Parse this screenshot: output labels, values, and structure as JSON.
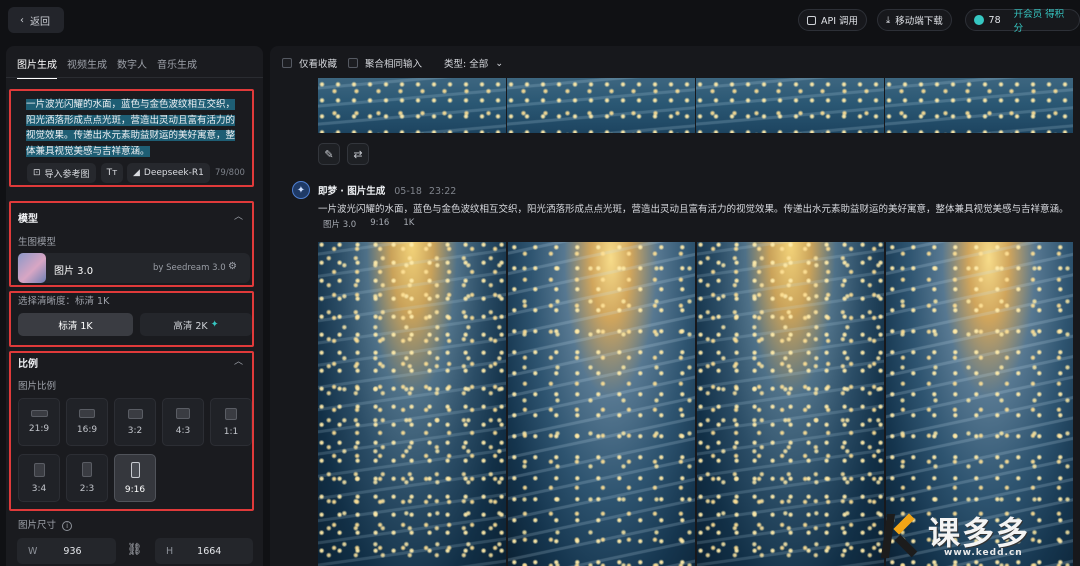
{
  "topbar": {
    "back_label": "返回",
    "api_label": "API 调用",
    "mobile_label": "移动端下载",
    "points": "78",
    "vip_label": "开会员 得积分"
  },
  "sidebar": {
    "tabs": [
      "图片生成",
      "视频生成",
      "数字人",
      "音乐生成"
    ],
    "prompt_text": "一片波光闪耀的水面，蓝色与金色波纹相互交织，阳光洒落形成点点光斑，营造出灵动且富有活力的视觉效果。传递出水元素助益财运的美好寓意，整体兼具视觉美感与吉祥意涵。",
    "ref_image_label": "导入参考图",
    "deepseek_label": "Deepseek-R1",
    "char_count": "79/800",
    "model_section": "模型",
    "model_sublabel": "生图模型",
    "model_name": "图片 3.0",
    "model_by": "by Seedream 3.0",
    "quality_label": "选择清晰度：标清 1K",
    "quality_options": [
      "标清 1K",
      "高清 2K"
    ],
    "ratio_section": "比例",
    "ratio_sublabel": "图片比例",
    "ratios": [
      "21:9",
      "16:9",
      "3:2",
      "4:3",
      "1:1",
      "3:4",
      "2:3",
      "9:16"
    ],
    "size_label": "图片尺寸",
    "width_label": "W",
    "width_value": "936",
    "height_label": "H",
    "height_value": "1664"
  },
  "main": {
    "filter_fav": "仅看收藏",
    "filter_merge": "聚合相同输入",
    "filter_type": "类型: 全部",
    "entry": {
      "author": "即梦 · 图片生成",
      "date": "05-18",
      "time": "23:22",
      "prompt": "一片波光闪耀的水面，蓝色与金色波纹相互交织，阳光洒落形成点点光斑，营造出灵动且富有活力的视觉效果。传递出水元素助益财运的美好寓意，整体兼具视觉美感与吉祥意涵。",
      "tags": [
        "图片 3.0",
        "9:16",
        "1K"
      ]
    }
  },
  "watermark": {
    "text": "课多多",
    "url": "www.kedd.cn"
  }
}
